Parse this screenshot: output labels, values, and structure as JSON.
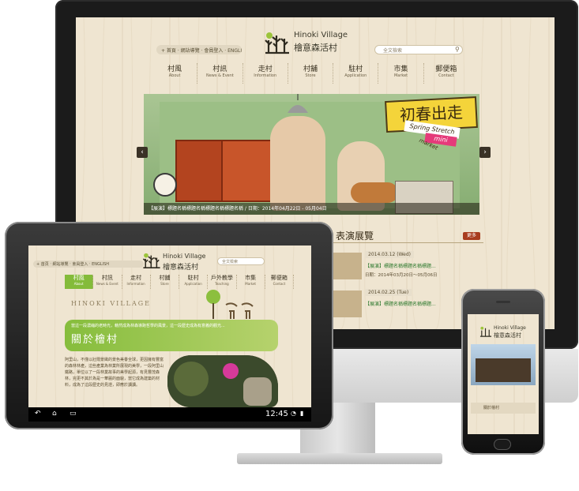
{
  "brand": {
    "name_en": "Hinoki Village",
    "name_zh": "檜意森活村"
  },
  "desktop": {
    "topbar": "+ 首頁 ‧ 網站導覽 ‧ 會員登入 ‧ ENGLISH",
    "search_placeholder": "全文檢索",
    "nav": [
      {
        "zh": "村風",
        "en": "About"
      },
      {
        "zh": "村訊",
        "en": "News & Event"
      },
      {
        "zh": "走村",
        "en": "Information"
      },
      {
        "zh": "村舖",
        "en": "Store"
      },
      {
        "zh": "駐村",
        "en": "Application"
      },
      {
        "zh": "市集",
        "en": "Market"
      },
      {
        "zh": "郵便箱",
        "en": "Contact"
      }
    ],
    "banner": {
      "sign": "初春出走",
      "sign_en": "Spring Stretch",
      "sign_mini": "mini",
      "sign_market": "market",
      "caption": "【展演】標題名稱標題名稱標題名稱標題名稱 / 日期：2014年04月22日 - 05月04日",
      "prev": "‹",
      "next": "›"
    },
    "performance": {
      "title": "表演展覽",
      "more": "更多",
      "items": [
        {
          "date": "2014.03.12 (Wed)",
          "title": "【展演】標題名稱標題名稱標題...",
          "sub": "日期：2014年03月20日～05月06日"
        },
        {
          "date": "2014.02.25 (Tue)",
          "title": "【展演】標題名稱標題名稱標題...",
          "sub": ""
        }
      ]
    }
  },
  "tablet": {
    "topbar": "+ 首頁 ‧ 網站導覽 ‧ 會員登入 ‧ ENGLISH",
    "search_placeholder": "全文檢索",
    "nav": [
      {
        "zh": "村風",
        "en": "About"
      },
      {
        "zh": "村訊",
        "en": "News & Event"
      },
      {
        "zh": "走村",
        "en": "Information"
      },
      {
        "zh": "村舖",
        "en": "Store"
      },
      {
        "zh": "駐村",
        "en": "Application"
      },
      {
        "zh": "戶外教學",
        "en": "Teaching"
      },
      {
        "zh": "市集",
        "en": "Market"
      },
      {
        "zh": "郵便箱",
        "en": "Contact"
      }
    ],
    "hero_title": "HINOKI VILLAGE",
    "green_msg": "當這一段濃縮的老時光，藉然成為林森導跑哲學的風景，這一段歷史成為有意義的觀光...",
    "green_heading": "關於檜村",
    "body": "阿里山，不僅以壯闊景緻的景色美譽全球，更因擁有豐富的森林林產，這些產業為林業所展現的美學，一段阿里山鐵路，單位以了一段林業故事的美學起源，有見豐茂森林，完更不其於為是一華麗的面貌，當它成為建築的材料，成為了這段歷史的見證，即應於讀讀。",
    "status_time": "12:45",
    "status_icons": [
      "back-icon",
      "home-icon",
      "recent-apps-icon"
    ]
  },
  "phone": {
    "band": "關於檜村"
  }
}
